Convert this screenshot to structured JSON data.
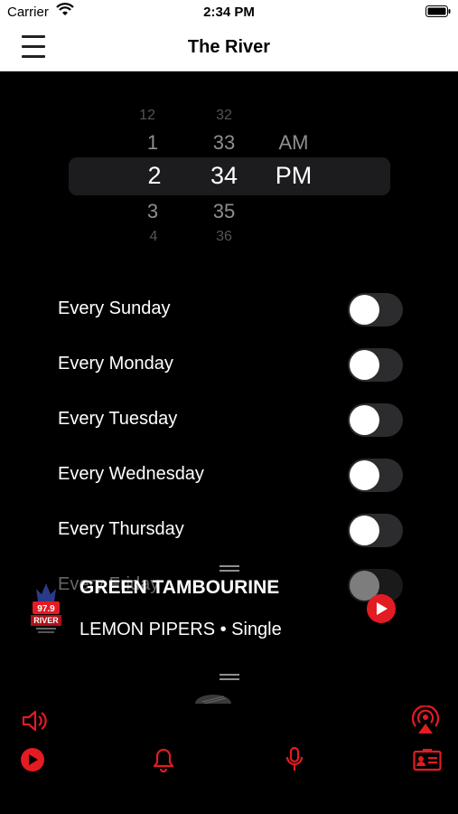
{
  "status_bar": {
    "carrier": "Carrier",
    "time": "2:34 PM"
  },
  "nav": {
    "title": "The River"
  },
  "time_picker": {
    "hours": [
      "12",
      "1",
      "2",
      "3",
      "4"
    ],
    "minutes": [
      "32",
      "33",
      "34",
      "35",
      "36"
    ],
    "periods": [
      "AM",
      "PM"
    ],
    "selected": {
      "hour": "2",
      "minute": "34",
      "period": "PM"
    }
  },
  "days": [
    {
      "label": "Every Sunday",
      "on": false
    },
    {
      "label": "Every Monday",
      "on": false
    },
    {
      "label": "Every Tuesday",
      "on": false
    },
    {
      "label": "Every Wednesday",
      "on": false
    },
    {
      "label": "Every Thursday",
      "on": false
    },
    {
      "label": "Every Friday",
      "on": false
    }
  ],
  "now_playing": {
    "title": "GREEN TAMBOURINE",
    "subtitle": "LEMON PIPERS • Single",
    "art_label": "97.9 RIVER"
  },
  "colors": {
    "accent": "#e31b23",
    "background": "#000000",
    "toggle_off": "#2c2c2e"
  },
  "bottom_icons": [
    "volume-icon",
    "airplay-audio-icon",
    "play-circle-icon",
    "alarm-bell-icon",
    "microphone-icon",
    "contact-card-icon"
  ]
}
